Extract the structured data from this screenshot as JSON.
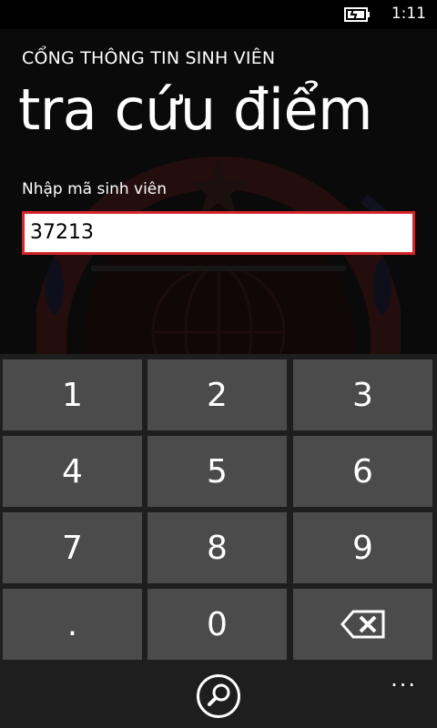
{
  "status_bar": {
    "time": "1:11",
    "battery_icon": "battery-charging-icon"
  },
  "app": {
    "title": "CỔNG THÔNG TIN SINH VIÊN"
  },
  "page": {
    "title": "tra cứu điểm"
  },
  "form": {
    "label": "Nhập mã sinh viên",
    "student_id_value": "37213",
    "accent_border": "#d3262a"
  },
  "keypad": {
    "keys": [
      "1",
      "2",
      "3",
      "4",
      "5",
      "6",
      "7",
      "8",
      "9",
      ".",
      "0"
    ],
    "backspace_icon": "backspace-icon"
  },
  "app_bar": {
    "search_icon": "search-icon",
    "more_label": "..."
  },
  "colors": {
    "background": "#0a0a0a",
    "key": "#4b4b4b",
    "keypad_bg": "#1e1e1e"
  }
}
